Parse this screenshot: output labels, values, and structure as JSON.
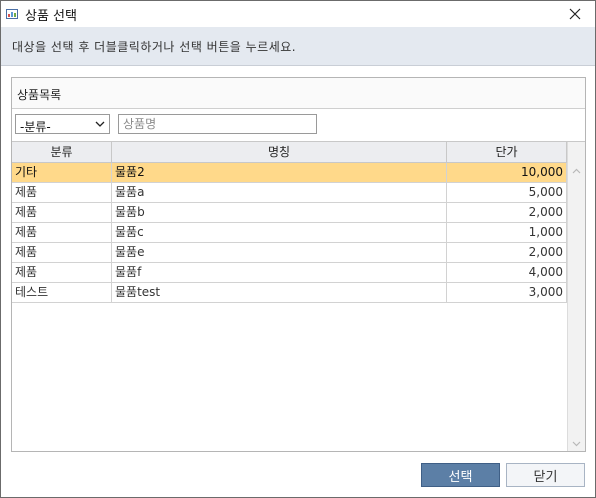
{
  "window": {
    "title": "상품 선택",
    "icon": "chart-icon"
  },
  "banner": {
    "text": "대상을 선택 후 더블클릭하거나 선택 버튼을 누르세요."
  },
  "panel": {
    "title": "상품목록"
  },
  "filter": {
    "category_value": "-분류-",
    "search_placeholder": "상품명",
    "search_value": ""
  },
  "table": {
    "columns": [
      "분류",
      "명칭",
      "단가"
    ],
    "rows": [
      {
        "category": "기타",
        "name": "물품2",
        "price": "10,000",
        "selected": true
      },
      {
        "category": "제품",
        "name": "물품a",
        "price": "5,000",
        "selected": false
      },
      {
        "category": "제품",
        "name": "물품b",
        "price": "2,000",
        "selected": false
      },
      {
        "category": "제품",
        "name": "물품c",
        "price": "1,000",
        "selected": false
      },
      {
        "category": "제품",
        "name": "물품e",
        "price": "2,000",
        "selected": false
      },
      {
        "category": "제품",
        "name": "물품f",
        "price": "4,000",
        "selected": false
      },
      {
        "category": "테스트",
        "name": "물품test",
        "price": "3,000",
        "selected": false
      }
    ]
  },
  "buttons": {
    "select_label": "선택",
    "close_label": "닫기"
  },
  "colors": {
    "selected_row": "#ffd98a",
    "primary_button": "#5c7fa6",
    "banner": "#e4e9f0"
  }
}
